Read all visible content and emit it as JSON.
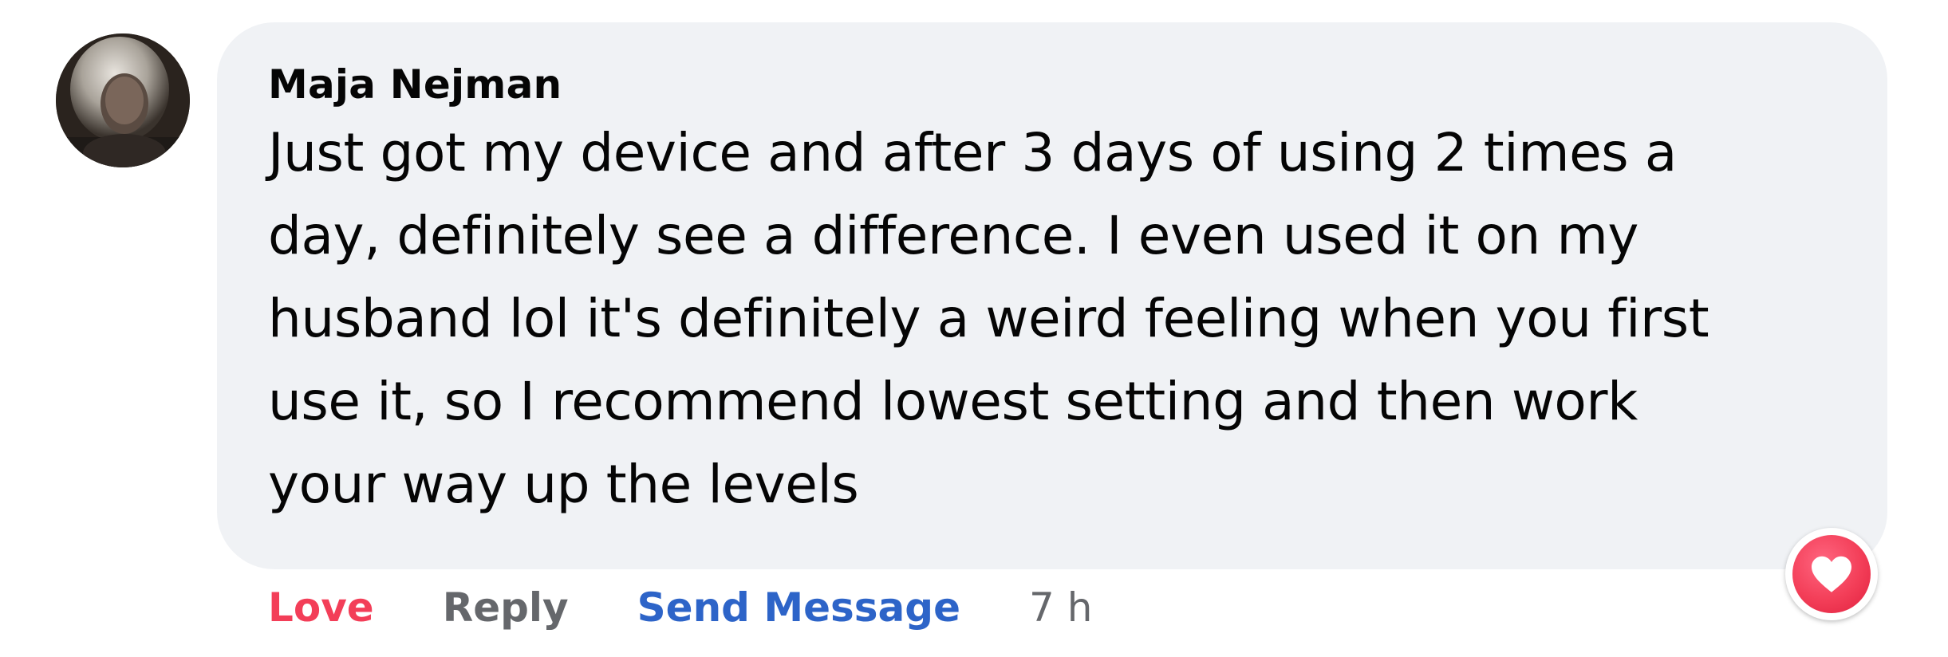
{
  "comment": {
    "author": "Maja Nejman",
    "text_lines": [
      "Just got my device and after 3 days of using 2 times a",
      "day, definitely see a difference. I even used it on my",
      "husband lol it's definitely a weird feeling when you first",
      "use it, so I recommend lowest setting and then work",
      "your way up the levels"
    ],
    "reaction_icon": "heart-icon"
  },
  "actions": {
    "love_label": "Love",
    "reply_label": "Reply",
    "send_message_label": "Send Message",
    "timestamp": "7 h"
  },
  "colors": {
    "bubble_background": "#f0f2f5",
    "love": "#f33e58",
    "reply": "#65676b",
    "send_message": "#2d64c8",
    "text": "#050505"
  }
}
